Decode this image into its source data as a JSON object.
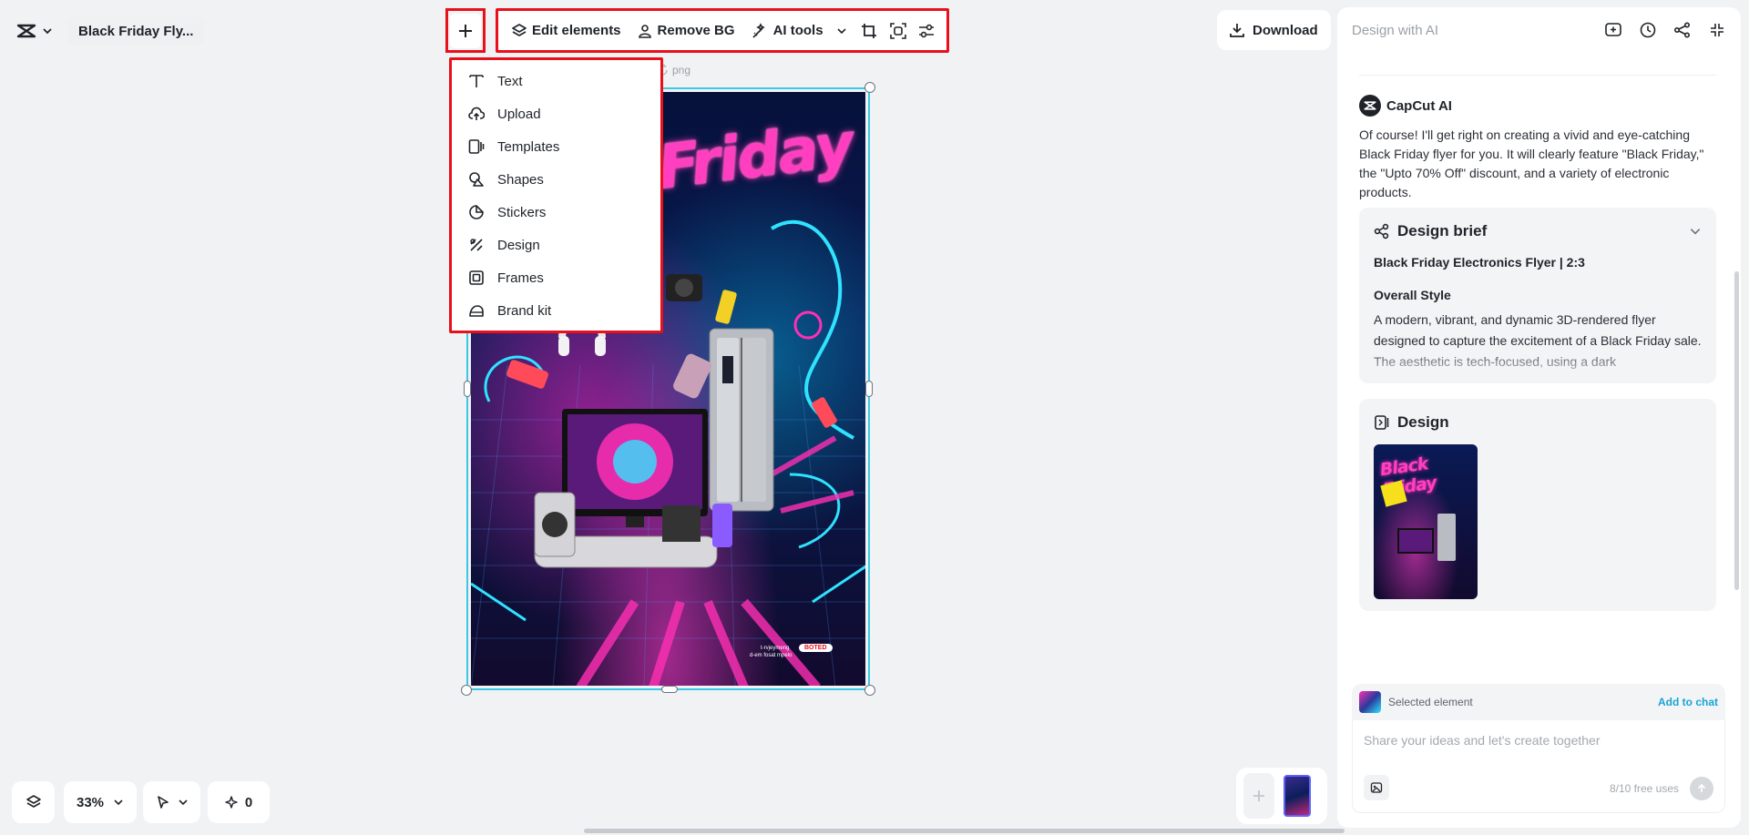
{
  "header": {
    "project_title": "Black Friday Fly..."
  },
  "toolbar": {
    "edit_elements": "Edit elements",
    "remove_bg": "Remove BG",
    "ai_tools": "AI tools"
  },
  "download_label": "Download",
  "canvas": {
    "file_label": "png",
    "flyer_title": "Friday",
    "flyer_badge": "BOTED",
    "flyer_footnote_1": "t-rvjeymeng",
    "flyer_footnote_2": "d-em fosat mpelo"
  },
  "add_menu": {
    "items": [
      {
        "label": "Text",
        "icon": "text-icon"
      },
      {
        "label": "Upload",
        "icon": "upload-icon"
      },
      {
        "label": "Templates",
        "icon": "templates-icon"
      },
      {
        "label": "Shapes",
        "icon": "shapes-icon"
      },
      {
        "label": "Stickers",
        "icon": "stickers-icon"
      },
      {
        "label": "Design",
        "icon": "design-icon"
      },
      {
        "label": "Frames",
        "icon": "frames-icon"
      },
      {
        "label": "Brand kit",
        "icon": "brand-kit-icon"
      }
    ]
  },
  "bottom_bar": {
    "zoom": "33%",
    "credits": "0"
  },
  "ai_panel": {
    "title": "Design with AI",
    "assistant_name": "CapCut AI",
    "message": "Of course! I'll get right on creating a vivid and eye-catching Black Friday flyer for you. It will clearly feature \"Black Friday,\" the \"Upto 70% Off\" discount, and a variety of electronic products.",
    "brief": {
      "heading": "Design brief",
      "subtitle": "Black Friday Electronics Flyer | 2:3",
      "style_heading": "Overall Style",
      "style_text": "A modern, vibrant, and dynamic 3D-rendered flyer designed to capture the excitement of a Black Friday sale. The aesthetic is tech-focused, using a dark"
    },
    "design": {
      "heading": "Design",
      "thumb_title": "Black Friday"
    },
    "selected_element": "Selected element",
    "add_to_chat": "Add to chat",
    "chat_placeholder": "Share your ideas and let's create together",
    "free_uses": "8/10 free uses"
  },
  "colors": {
    "highlight": "#e8101a",
    "selection": "#3cc7e4",
    "link": "#1aa3d4",
    "neon_pink": "#ff2fb4"
  }
}
